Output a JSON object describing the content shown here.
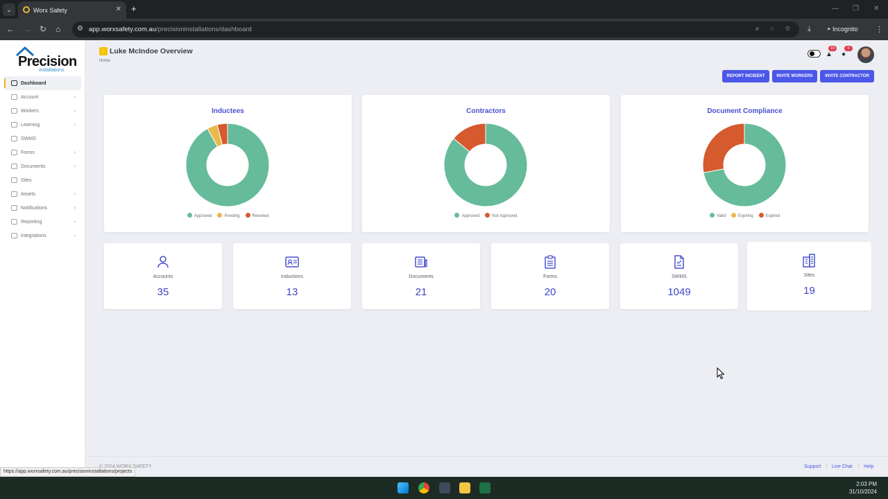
{
  "browser": {
    "tab_title": "Worx Safety",
    "tab_close": "✕",
    "new_tab": "+",
    "url_host": "app.worxsafety.com.au",
    "url_path": "/precisioninstallations/dashboard",
    "profile_label": "Incognito"
  },
  "brand": {
    "name": "Precision",
    "tagline": "installations"
  },
  "sidebar": {
    "items": [
      {
        "label": "Dashboard"
      },
      {
        "label": "Account"
      },
      {
        "label": "Workers"
      },
      {
        "label": "Learning"
      },
      {
        "label": "SWMS"
      },
      {
        "label": "Forms"
      },
      {
        "label": "Documents"
      },
      {
        "label": "Sites"
      },
      {
        "label": "Assets"
      },
      {
        "label": "Notifications"
      },
      {
        "label": "Reporting"
      },
      {
        "label": "Integrations"
      }
    ]
  },
  "header": {
    "title": "Luke McIndoe Overview",
    "breadcrumb": "Home",
    "alerts_count": "10",
    "notifications_count": "0"
  },
  "actions": {
    "report_incident": "REPORT INCIDENT",
    "invite_workers": "INVITE WORKERS",
    "invite_contractor": "INVITE CONTRACTOR"
  },
  "colors": {
    "green": "#66bb9a",
    "amber": "#e9b949",
    "red": "#d55a2d",
    "accent": "#4b57e8"
  },
  "chart_data": [
    {
      "type": "pie",
      "title": "Inductees",
      "categories": [
        "Approved",
        "Pending",
        "Revoked"
      ],
      "values": [
        92,
        4,
        4
      ]
    },
    {
      "type": "pie",
      "title": "Contractors",
      "categories": [
        "Approved",
        "Not Approved"
      ],
      "values": [
        86,
        14
      ]
    },
    {
      "type": "pie",
      "title": "Document Compliance",
      "categories": [
        "Valid",
        "Expiring",
        "Expired"
      ],
      "values": [
        72,
        0,
        28
      ]
    }
  ],
  "stats": [
    {
      "label": "Accounts",
      "value": "35",
      "icon": "user-icon"
    },
    {
      "label": "Inductions",
      "value": "13",
      "icon": "id-card-icon"
    },
    {
      "label": "Documents",
      "value": "21",
      "icon": "newspaper-icon"
    },
    {
      "label": "Forms",
      "value": "20",
      "icon": "clipboard-icon"
    },
    {
      "label": "SWMS",
      "value": "1049",
      "icon": "document-icon"
    },
    {
      "label": "Sites",
      "value": "19",
      "icon": "building-icon"
    }
  ],
  "footer": {
    "copyright": "© 2024 WORX SAFETY",
    "support": "Support",
    "live_chat": "Live Chat",
    "help": "Help",
    "separator": "|"
  },
  "status_url": "https://app.worxsafety.com.au/precisioninstallations/projects",
  "clock": {
    "time": "2:03 PM",
    "date": "31/10/2024"
  }
}
